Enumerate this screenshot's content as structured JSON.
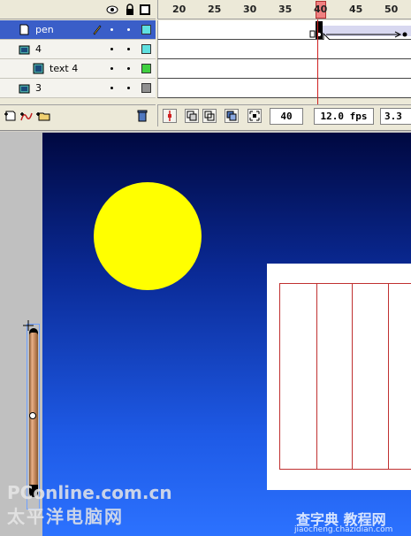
{
  "timeline": {
    "ruler_numbers": [
      "20",
      "25",
      "30",
      "35",
      "40",
      "45",
      "50"
    ],
    "current_frame_marker": "40",
    "layers": [
      {
        "name": "pen",
        "color": "#5fe0e0",
        "selected": true,
        "type": "layer"
      },
      {
        "name": "4",
        "color": "#5fe0e0",
        "selected": false,
        "type": "folder"
      },
      {
        "name": "text 4",
        "color": "#40d040",
        "selected": false,
        "type": "layer"
      },
      {
        "name": "3",
        "color": "#909090",
        "selected": false,
        "type": "folder"
      }
    ],
    "current_frame": "40",
    "frame_rate": "12.0 fps",
    "elapsed_time": "3.3"
  },
  "watermarks": {
    "left_line1": "PConline.com.cn",
    "left_line2": "太平洋电脑网",
    "right_line1": "查字典 教程网",
    "right_line2": "jiaocheng.chazidian.com"
  },
  "colors": {
    "selection": "#3a5ec8",
    "playhead": "#d02020",
    "sun": "#ffff00",
    "sky_top": "#000840",
    "sky_bottom": "#2c72ff"
  }
}
